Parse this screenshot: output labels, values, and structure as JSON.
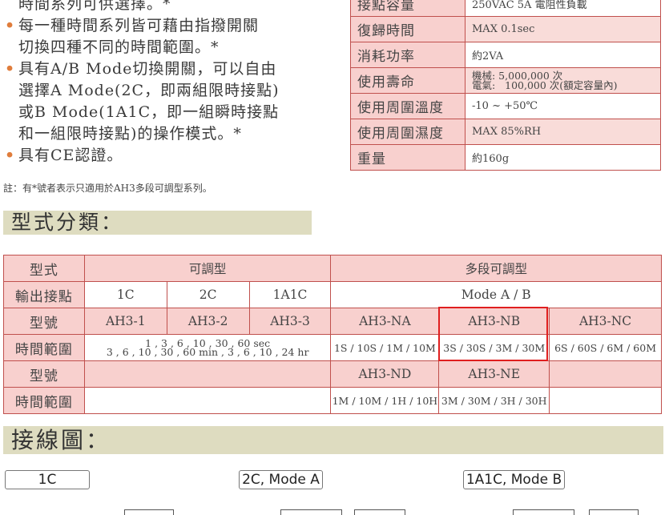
{
  "features": {
    "bullets": [
      {
        "lines": [
          "時間系列可供選擇。*"
        ],
        "dot": false
      },
      {
        "lines": [
          "每一種時間系列皆可藉由指撥開關",
          "切換四種不同的時間範圍。*"
        ],
        "dot": true
      },
      {
        "lines": [
          "具有A/B Mode切換開關，可以自由",
          "選擇A Mode(2C，即兩組限時接點)",
          "或B Mode(1A1C，即一組瞬時接點",
          "和一組限時接點)的操作模式。*"
        ],
        "dot": true
      },
      {
        "lines": [
          "具有CE認證。"
        ],
        "dot": true
      }
    ],
    "bullet_symbol": "•",
    "note": "註：有*號者表示只適用於AH3多段可調型系列。"
  },
  "specs": [
    {
      "key": "接點容量",
      "value": "250VAC 5A 電阻性負載"
    },
    {
      "key": "復歸時間",
      "value": "MAX 0.1sec"
    },
    {
      "key": "消耗功率",
      "value": "約2VA"
    },
    {
      "key": "使用壽命",
      "value_lines": [
        "機械: 5,000,000 次",
        "電氣:   100,000 次(額定容量內)"
      ]
    },
    {
      "key": "使用周圍溫度",
      "value": "-10 ~ +50℃"
    },
    {
      "key": "使用周圍濕度",
      "value": "MAX 85%RH"
    },
    {
      "key": "重量",
      "value": "約160g"
    }
  ],
  "section_types": {
    "title": "型式分類："
  },
  "type_table": {
    "header": {
      "label": "型式",
      "adjustable": "可調型",
      "multi": "多段可調型"
    },
    "output": {
      "label": "輸出接點",
      "c1": "1C",
      "c2": "2C",
      "c3": "1A1C",
      "mode": "Mode A / B"
    },
    "model1": {
      "label": "型號",
      "c1": "AH3-1",
      "c2": "AH3-2",
      "c3": "AH3-3",
      "na": "AH3-NA",
      "nb": "AH3-NB",
      "nc": "AH3-NC"
    },
    "range1": {
      "label": "時間範圍",
      "adj_line1": "1 , 3 , 6 , 10 , 30 , 60 sec",
      "adj_line2": "3 , 6 , 10 , 30 , 60 min , 3 , 6 , 10 , 24 hr",
      "na": "1S / 10S / 1M / 10M",
      "nb": "3S / 30S / 3M / 30M",
      "nc": "6S / 60S / 6M / 60M"
    },
    "model2": {
      "label": "型號",
      "nd": "AH3-ND",
      "ne": "AH3-NE"
    },
    "range2": {
      "label": "時間範圍",
      "nd": "1M / 10M / 1H / 10H",
      "ne": "3M / 30M / 3H / 30H"
    }
  },
  "section_wiring": {
    "title": "接線圖："
  },
  "wiring_labels": [
    "1C",
    "2C, Mode A",
    "1A1C, Mode B"
  ],
  "colors": {
    "header_fill": "#f8d0ce",
    "border": "#c0504d",
    "highlight": "#e01f1f",
    "section_bar": "#dedcc0",
    "bullet": "#e07d3c"
  }
}
